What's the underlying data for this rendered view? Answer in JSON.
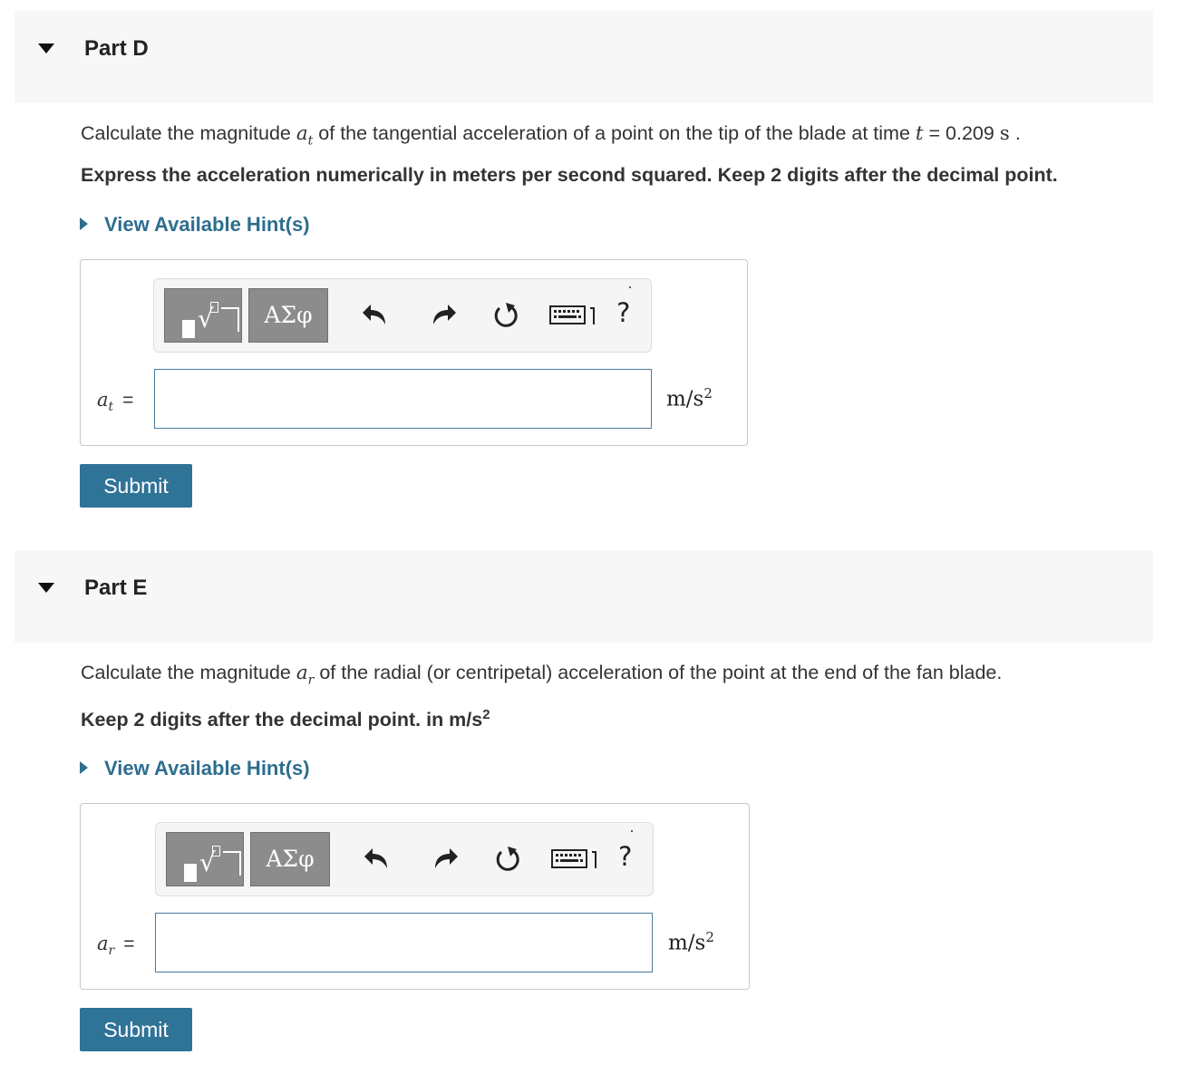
{
  "part_d": {
    "title": "Part D",
    "question_prefix": "Calculate the magnitude ",
    "question_var": "a",
    "question_var_sub": "t",
    "question_middle": " of the tangential acceleration of a point on the tip of the blade at time ",
    "question_time_var": "t",
    "question_time_value": " = 0.209 ",
    "question_time_unit": "s",
    "question_end": " .",
    "instruction": "Express the acceleration numerically in meters per second squared. Keep 2 digits after the decimal point.",
    "hint_label": "View Available Hint(s)",
    "answer_var": "a",
    "answer_var_sub": "t",
    "answer_eq": "=",
    "answer_value": "",
    "unit_base": "m/s",
    "unit_exp": "2",
    "submit_label": "Submit"
  },
  "part_e": {
    "title": "Part E",
    "question_prefix": "Calculate the magnitude ",
    "question_var": "a",
    "question_var_sub": "r",
    "question_end": " of the radial (or centripetal) acceleration of the point at the end of the fan blade.",
    "instruction_text": "Keep 2 digits after the decimal point. in m/s",
    "instruction_exp": "2",
    "hint_label": "View Available Hint(s)",
    "answer_var": "a",
    "answer_var_sub": "r",
    "answer_eq": "=",
    "answer_value": "",
    "unit_base": "m/s",
    "unit_exp": "2",
    "submit_label": "Submit"
  },
  "toolbar": {
    "greek_label": "ΑΣφ",
    "help_label": "?",
    "icons": [
      "templates-icon",
      "greek-letters-icon",
      "undo-icon",
      "redo-icon",
      "reset-icon",
      "keyboard-icon",
      "help-icon"
    ]
  },
  "colors": {
    "link": "#2d6e8e",
    "submit_bg": "#2f7397",
    "header_bg": "#f7f7f7",
    "toolbar_button": "#8c8c8c"
  }
}
